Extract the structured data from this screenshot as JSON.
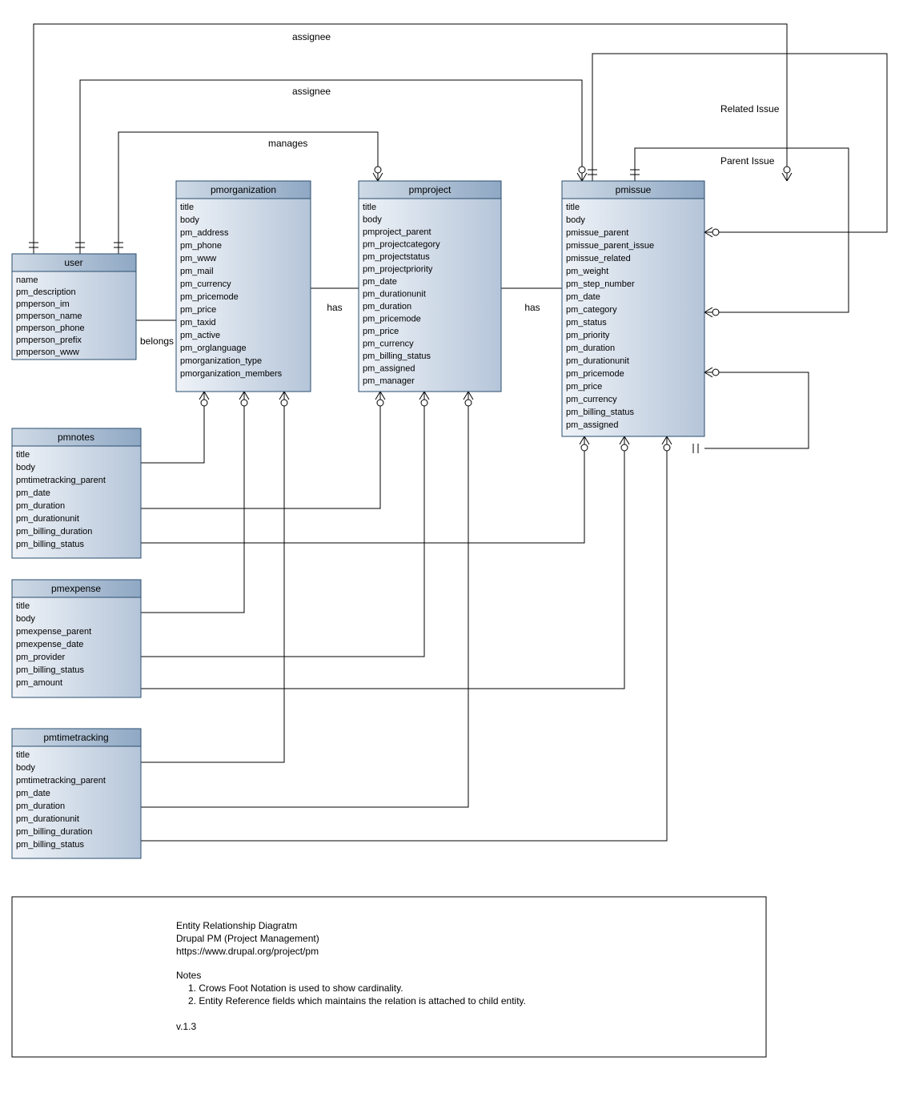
{
  "entities": {
    "user": {
      "title": "user",
      "fields": [
        "name",
        "pm_description",
        "pmperson_im",
        "pmperson_name",
        "pmperson_phone",
        "pmperson_prefix",
        "pmperson_www"
      ]
    },
    "pmorganization": {
      "title": "pmorganization",
      "fields": [
        "title",
        "body",
        "pm_address",
        "pm_phone",
        "pm_www",
        "pm_mail",
        "pm_currency",
        "pm_pricemode",
        "pm_price",
        "pm_taxid",
        "pm_active",
        "pm_orglanguage",
        "pmorganization_type",
        "pmorganization_members"
      ]
    },
    "pmproject": {
      "title": "pmproject",
      "fields": [
        "title",
        "body",
        "pmproject_parent",
        "pm_projectcategory",
        "pm_projectstatus",
        "pm_projectpriority",
        "pm_date",
        "pm_durationunit",
        "pm_duration",
        "pm_pricemode",
        "pm_price",
        "pm_currency",
        "pm_billing_status",
        "pm_assigned",
        "pm_manager"
      ]
    },
    "pmissue": {
      "title": "pmissue",
      "fields": [
        "title",
        "body",
        "pmissue_parent",
        "pmissue_parent_issue",
        "pmissue_related",
        "pm_weight",
        "pm_step_number",
        "pm_date",
        "pm_category",
        "pm_status",
        "pm_priority",
        "pm_duration",
        "pm_durationunit",
        "pm_pricemode",
        "pm_price",
        "pm_currency",
        "pm_billing_status",
        "pm_assigned"
      ]
    },
    "pmnotes": {
      "title": "pmnotes",
      "fields": [
        "title",
        "body",
        "pmtimetracking_parent",
        "pm_date",
        "pm_duration",
        "pm_durationunit",
        "pm_billing_duration",
        "pm_billing_status"
      ]
    },
    "pmexpense": {
      "title": "pmexpense",
      "fields": [
        "title",
        "body",
        "pmexpense_parent",
        "pmexpense_date",
        "pm_provider",
        "pm_billing_status",
        "pm_amount"
      ]
    },
    "pmtimetracking": {
      "title": "pmtimetracking",
      "fields": [
        "title",
        "body",
        "pmtimetracking_parent",
        "pm_date",
        "pm_duration",
        "pm_durationunit",
        "pm_billing_duration",
        "pm_billing_status"
      ]
    }
  },
  "labels": {
    "assignee1": "assignee",
    "assignee2": "assignee",
    "manages": "manages",
    "belongs": "belongs",
    "has1": "has",
    "has2": "has",
    "related": "Related Issue",
    "parent": "Parent Issue"
  },
  "legend": {
    "l1": "Entity Relationship Diagratm",
    "l2": "Drupal PM (Project Management)",
    "l3": "https://www.drupal.org/project/pm",
    "l4": "Notes",
    "l5": "1. Crows Foot Notation is used to show cardinality.",
    "l6": "2. Entity Reference fields which maintains the relation is attached to child entity.",
    "l7": "v.1.3"
  }
}
